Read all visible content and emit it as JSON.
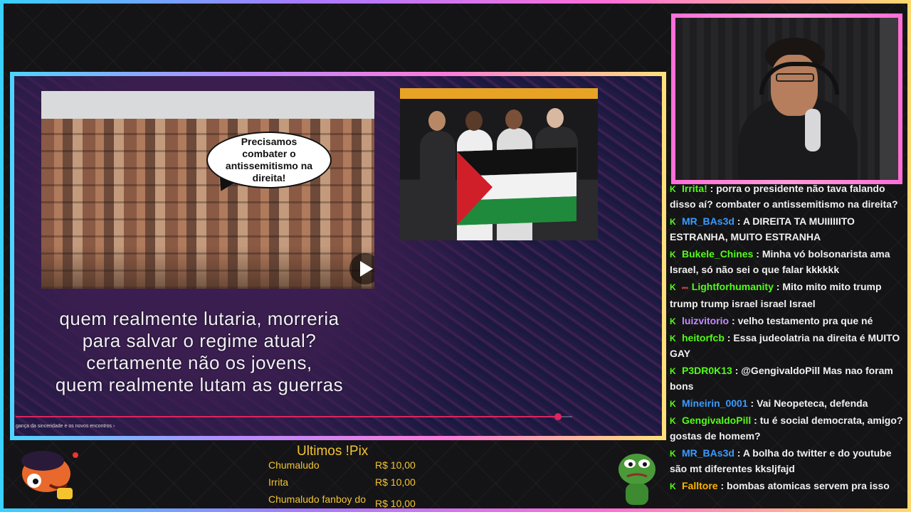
{
  "video": {
    "bubble_text": "Precisamos combater o antissemitismo na direita!",
    "caption_lines": [
      "quem realmente lutaria, morreria",
      "para salvar o regime atual?",
      "certamente não os jovens,",
      "quem realmente lutam as guerras"
    ],
    "title": "gança da sinceridade e os novos encontros",
    "progress": 0.975
  },
  "chat": {
    "messages": [
      {
        "user": "Irrita!",
        "user_color": "#53fc18",
        "text": "porra o presidente não tava falando disso aí? combater o antissemitismo na direita?"
      },
      {
        "user": "MR_BAs3d",
        "user_color": "#3b9bff",
        "text": "A DIREITA TA MUIIIIIITO ESTRANHA, MUITO ESTRANHA"
      },
      {
        "user": "Bukele_Chines",
        "user_color": "#53fc18",
        "text": "Minha vó bolsonarista ama Israel, só não sei o que falar kkkkkk"
      },
      {
        "user": "Lightforhumanity",
        "user_color": "#53fc18",
        "text": "Mito mito mito trump trump trump israel israel Israel",
        "emote": true
      },
      {
        "user": "luizvitorio",
        "user_color": "#c18cff",
        "text": "velho testamento pra que né"
      },
      {
        "user": "heitorfcb",
        "user_color": "#53fc18",
        "text": "Essa judeolatria na direita é MUITO GAY"
      },
      {
        "user": "P3DR0K13",
        "user_color": "#53fc18",
        "text": "@GengivaldoPill Mas nao foram bons"
      },
      {
        "user": "Mineirin_0001",
        "user_color": "#3b9bff",
        "text": "Vai Neopeteca, defenda"
      },
      {
        "user": "GengivaldoPill",
        "user_color": "#53fc18",
        "text": "tu é social democrata, amigo? gostas de homem?"
      },
      {
        "user": "MR_BAs3d",
        "user_color": "#3b9bff",
        "text": "A bolha do twitter e do youtube são mt diferentes kksljfajd"
      },
      {
        "user": "Falltore",
        "user_color": "#ffb400",
        "text": "bombas atomicas servem pra isso"
      }
    ]
  },
  "pix": {
    "title": "Ultimos !Pix",
    "items": [
      {
        "name": "Chumaludo",
        "amount": "R$ 10,00"
      },
      {
        "name": "Irrita",
        "amount": "R$ 10,00"
      },
      {
        "name": "Chumaludo fanboy do",
        "amount": "R$ 10,00"
      }
    ]
  },
  "icons": {
    "chat_badge": "kick-badge-icon",
    "play": "play-icon"
  },
  "colors": {
    "accent_pink": "#ff6fd8",
    "pix_gold": "#f4c430",
    "kick_green": "#53fc18"
  }
}
